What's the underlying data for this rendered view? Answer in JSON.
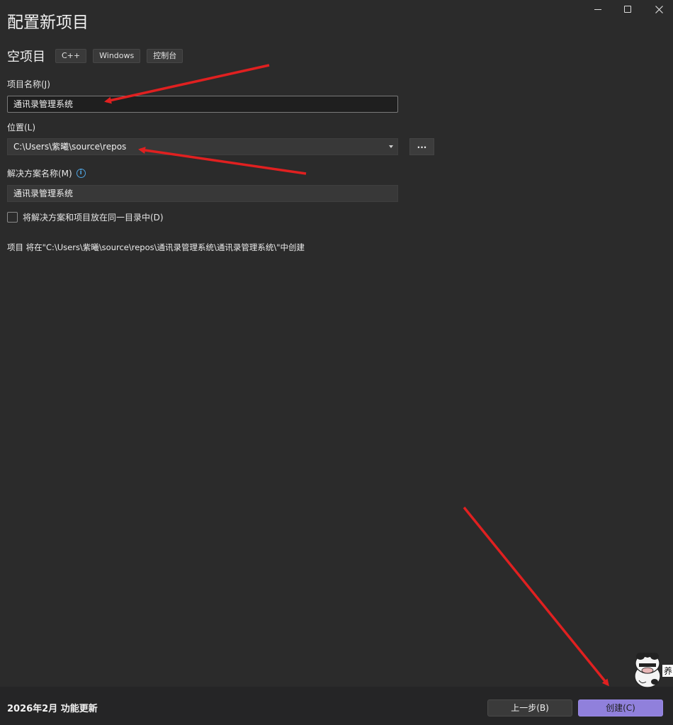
{
  "window": {
    "title": "配置新项目",
    "controls": {
      "minimize": "minimize",
      "maximize": "maximize",
      "close": "close"
    }
  },
  "template": {
    "name": "空项目",
    "tags": [
      "C++",
      "Windows",
      "控制台"
    ]
  },
  "fields": {
    "project_name": {
      "label": "项目名称(J)",
      "value": "通讯录管理系统"
    },
    "location": {
      "label": "位置(L)",
      "value": "C:\\Users\\紫曦\\source\\repos",
      "browse_label": "..."
    },
    "solution_name": {
      "label": "解决方案名称(M)",
      "value": "通讯录管理系统",
      "info_icon": "i"
    }
  },
  "checkbox": {
    "label": "将解决方案和项目放在同一目录中(D)",
    "checked": false
  },
  "summary": "项目 将在\"C:\\Users\\紫曦\\source\\repos\\通讯录管理系统\\通讯录管理系统\\\"中创建",
  "footer": {
    "update_text": "2026年2月 功能更新",
    "back_label": "上一步(B)",
    "create_label": "创建(C)"
  },
  "sticker": {
    "text": "养"
  },
  "colors": {
    "background": "#2b2b2b",
    "footer": "#252526",
    "accent": "#9080dc",
    "annotation_arrow": "#e02020",
    "info_icon": "#4fa3e0"
  }
}
